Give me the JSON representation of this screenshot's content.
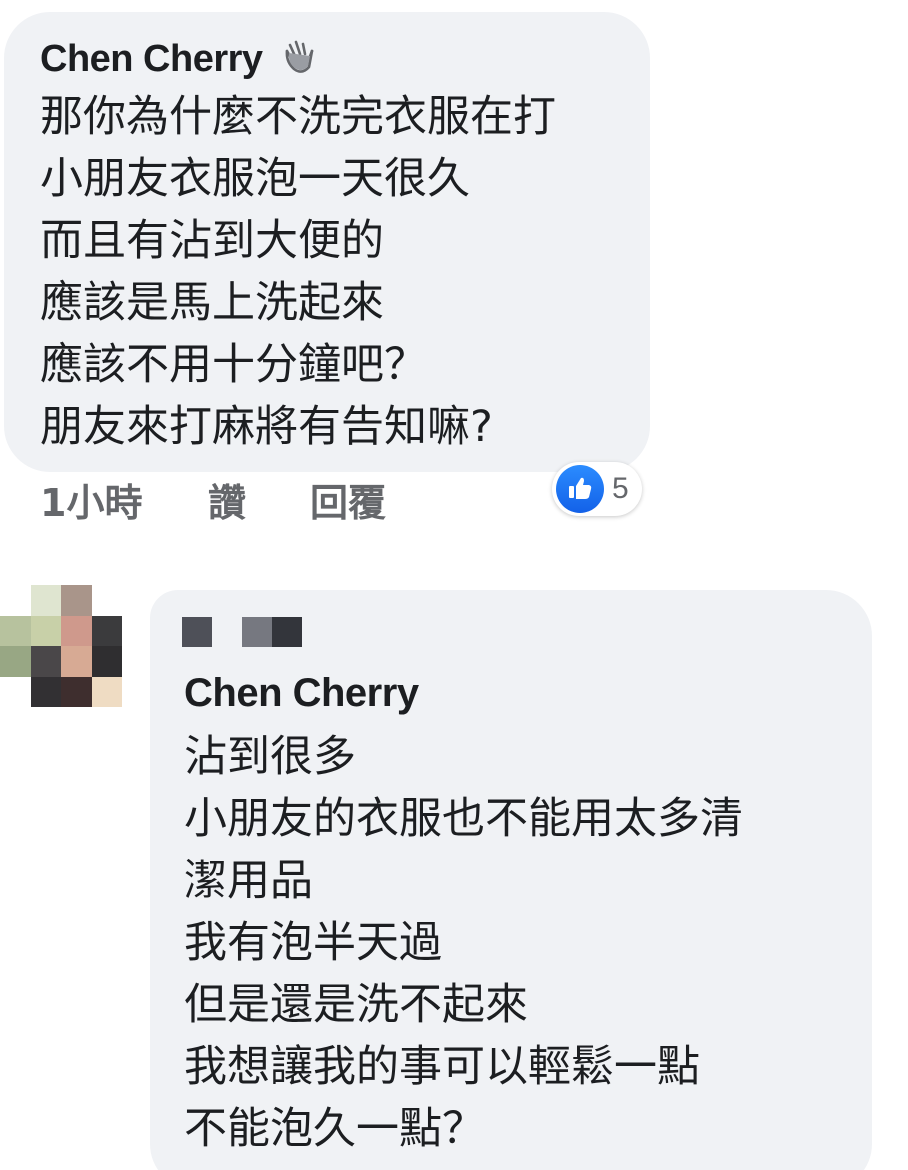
{
  "comment_1": {
    "author": "Chen Cherry",
    "author_badge_icon": "waving-hand-icon",
    "lines": [
      "那你為什麼不洗完衣服在打",
      "小朋友衣服泡一天很久",
      "而且有沾到大便的",
      "應該是馬上洗起來",
      "應該不用十分鐘吧？",
      "朋友來打麻將有告知嘛?"
    ],
    "meta": {
      "time": "1小時",
      "like": "讚",
      "reply": "回覆"
    },
    "reactions": {
      "icon": "thumbs-up-icon",
      "count": "5",
      "accent_color": "#1877f2"
    }
  },
  "comment_2": {
    "author": "Chen Cherry",
    "lines": [
      "沾到很多",
      "小朋友的衣服也不能用太多清",
      "潔用品",
      "我有泡半天過",
      "但是還是洗不起來",
      "我想讓我的事可以輕鬆一點",
      "不能泡久一點？"
    ]
  },
  "avatar": {
    "description_icon": "pixelated-avatar",
    "colors": [
      "#ffffff",
      "#dfe5d0",
      "#a9958a",
      "#ffffff",
      "#b7c29e",
      "#c8d0a8",
      "#cf998c",
      "#3b3b3d",
      "#98a784",
      "#4a4749",
      "#d7aa94",
      "#2f2e30",
      "#ffffff",
      "#323033",
      "#3e2e2e",
      "#efdcc3"
    ]
  },
  "colors": {
    "bubble_bg": "#f0f2f5",
    "text": "#1c1e21",
    "meta_text": "#65676b"
  }
}
